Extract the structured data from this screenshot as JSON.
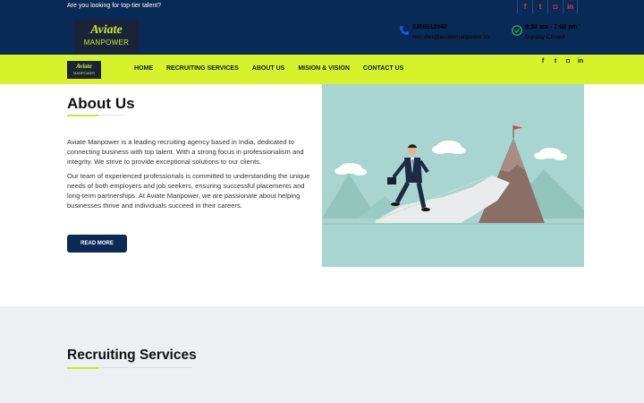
{
  "topbar": {
    "tagline": "Are you looking for top-tier talent?",
    "socials": [
      {
        "icon": "facebook-icon",
        "glyph": "f"
      },
      {
        "icon": "twitter-icon",
        "glyph": "t"
      },
      {
        "icon": "instagram-icon",
        "glyph": "◘"
      },
      {
        "icon": "linkedin-icon",
        "glyph": "in"
      }
    ]
  },
  "header": {
    "logo": {
      "line1": "Aviate",
      "line2": "MANPOWER"
    },
    "phone": "8356912040",
    "email": "recruiter@aviatemanpower.co",
    "hours": "9:30 am - 7:00 pm",
    "closed": "Sunday Closed"
  },
  "nav": {
    "logo": {
      "line1": "Aviate",
      "line2": "MANPOWER"
    },
    "items": [
      "HOME",
      "RECRUITING SERVICES",
      "ABOUT US",
      "MISION & VISION",
      "CONTACT US"
    ],
    "socials": [
      {
        "icon": "facebook-icon",
        "glyph": "f"
      },
      {
        "icon": "twitter-icon",
        "glyph": "t"
      },
      {
        "icon": "instagram-icon",
        "glyph": "◘"
      },
      {
        "icon": "linkedin-icon",
        "glyph": "in"
      }
    ]
  },
  "about": {
    "title": "About Us",
    "para1": "Aviate Manpower is a leading recruiting agency based in India, dedicated to connecting business with top talent. With a strong focus in professionalism and integrity. We strive to provide exceptional solutions to our clients.",
    "para2": "Our team of experienced professionals is committed to understanding the unique needs of both employers and job seekers, ensuring successful placements and long-term partnerships. At Aviate Manpower, we are passionate about helping businesses thrive and individuals succeed in their careers.",
    "button": "READ MORE",
    "illustration": "businessman-climbing-stairs-to-mountain-flag"
  },
  "services": {
    "title": "Recruiting Services"
  },
  "colors": {
    "navy": "#092a57",
    "lime": "#d6f22a",
    "accent_red": "#e8403a",
    "button": "#0b2b56",
    "section_gray": "#edf0f3",
    "illustration_bg": "#a8d5cf"
  }
}
